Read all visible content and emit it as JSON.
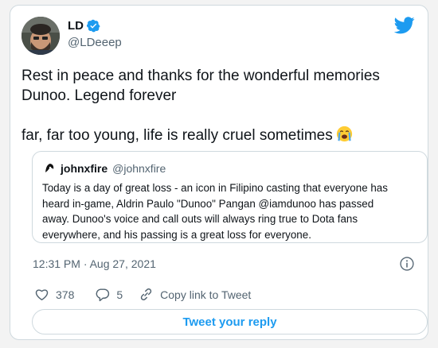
{
  "author": {
    "name": "LD",
    "handle": "@LDeeep"
  },
  "tweet": {
    "lines": [
      "Rest in peace and thanks for the wonderful memories",
      "Dunoo. Legend forever",
      "far, far too young, life is really cruel sometimes"
    ],
    "emoji": "loudly-crying-face"
  },
  "quoted": {
    "name": "johnxfire",
    "handle": "@johnxfire",
    "lines": [
      "Today is a day of great loss - an icon in Filipino casting that everyone has",
      "heard in-game, Aldrin Paulo \"Dunoo\" Pangan @iamdunoo has passed",
      "away. Dunoo's voice and call outs will always ring true to Dota fans",
      "everywhere, and his passing is a great loss for everyone."
    ]
  },
  "timestamp": "12:31 PM · Aug 27, 2021",
  "actions": {
    "likes": "378",
    "replies": "5",
    "copy_link": "Copy link to Tweet"
  },
  "reply_button": "Tweet your reply",
  "colors": {
    "accent": "#1d9bf0",
    "like": "#536471",
    "text": "#0f1419",
    "muted": "#536471"
  }
}
